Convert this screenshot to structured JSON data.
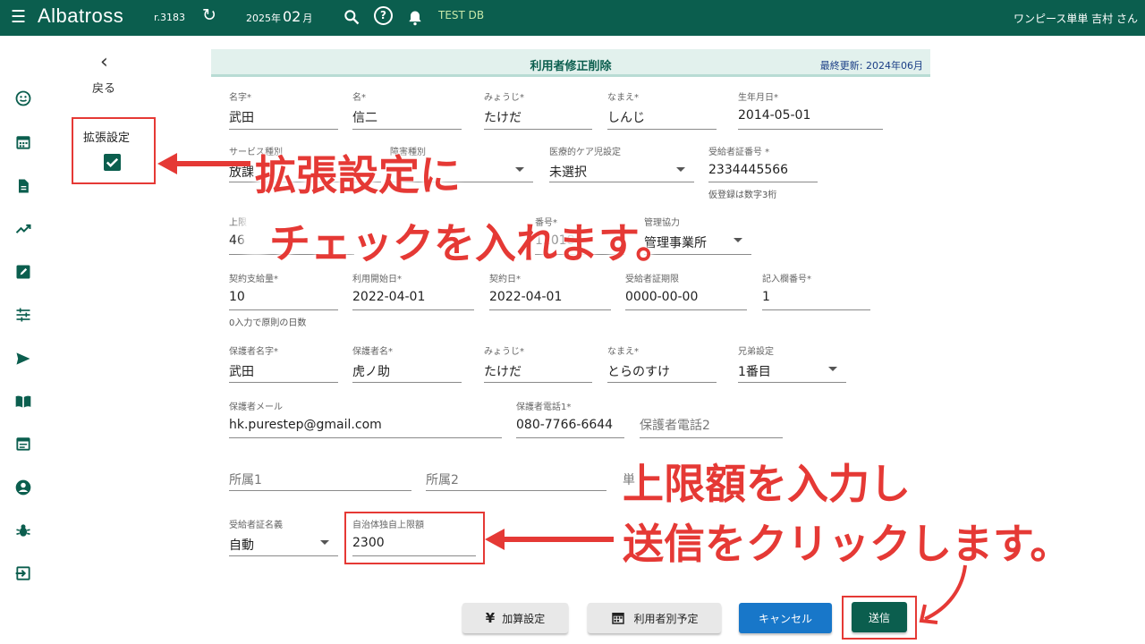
{
  "header": {
    "brand": "Albatross",
    "version": "r.3183",
    "month_year": "2025年",
    "month_num": "02",
    "month_unit": "月",
    "db_label": "TEST DB",
    "user": "ワンピース単単 吉村 さん"
  },
  "nav": {
    "back_label": "戻る",
    "ext_settings_label": "拡張設定",
    "ext_settings_checked": true,
    "rail_icons": [
      "smile-icon",
      "calendar-icon",
      "document-icon",
      "trending-icon",
      "edit-icon",
      "tune-icon",
      "send-icon",
      "book-icon",
      "schedule-icon",
      "account-icon",
      "bug-icon",
      "login-icon"
    ]
  },
  "page": {
    "title": "利用者修正削除",
    "updated": "最終更新: 2024年06月"
  },
  "form": {
    "row1": {
      "sei": {
        "label": "名字*",
        "value": "武田"
      },
      "mei": {
        "label": "名*",
        "value": "信二"
      },
      "sei_kana": {
        "label": "みょうじ*",
        "value": "たけだ"
      },
      "mei_kana": {
        "label": "なまえ*",
        "value": "しんじ"
      },
      "birthday": {
        "label": "生年月日*",
        "value": "2014-05-01"
      }
    },
    "row2": {
      "service": {
        "label": "サービス種別",
        "value": "放課"
      },
      "disability": {
        "label": "障害種別",
        "value": ""
      },
      "medical_care": {
        "label": "医療的ケア児設定",
        "value": "未選択"
      },
      "recipient_no": {
        "label": "受給者証番号 *",
        "value": "2334445566",
        "helper": "仮登録は数字3桁"
      }
    },
    "row3": {
      "limit": {
        "label": "上限",
        "value": "46"
      },
      "number": {
        "label": "番号*",
        "value": "12018"
      },
      "cooperation": {
        "label": "管理協力",
        "value": "管理事業所"
      }
    },
    "row4": {
      "contract_amount": {
        "label": "契約支給量*",
        "value": "10",
        "helper": "0入力で原則の日数"
      },
      "start_date": {
        "label": "利用開始日*",
        "value": "2022-04-01"
      },
      "contract_date": {
        "label": "契約日*",
        "value": "2022-04-01"
      },
      "cert_expiry": {
        "label": "受給者証期限",
        "value": "0000-00-00"
      },
      "entry_no": {
        "label": "記入欄番号*",
        "value": "1"
      }
    },
    "row5": {
      "guardian_sei": {
        "label": "保護者名字*",
        "value": "武田"
      },
      "guardian_mei": {
        "label": "保護者名*",
        "value": "虎ノ助"
      },
      "guardian_sei_kana": {
        "label": "みょうじ*",
        "value": "たけだ"
      },
      "guardian_mei_kana": {
        "label": "なまえ*",
        "value": "とらのすけ"
      },
      "sibling": {
        "label": "兄弟設定",
        "value": "1番目"
      }
    },
    "row6": {
      "email": {
        "label": "保護者メール",
        "value": "hk.purestep@gmail.com"
      },
      "tel1": {
        "label": "保護者電話1*",
        "value": "080-7766-6644"
      },
      "tel2": {
        "placeholder": "保護者電話2"
      }
    },
    "row7": {
      "affiliation1": {
        "placeholder": "所属1"
      },
      "affiliation2": {
        "placeholder": "所属2"
      },
      "unit": {
        "placeholder": "単"
      }
    },
    "row8": {
      "recipient_name": {
        "label": "受給者証名義",
        "value": "自動"
      },
      "municipal_limit": {
        "label": "自治体独自上限額",
        "value": "2300"
      }
    }
  },
  "buttons": {
    "addition": "加算設定",
    "schedule": "利用者別予定",
    "cancel": "キャンセル",
    "submit": "送信"
  },
  "annotations": {
    "a1_line1": "拡張設定に",
    "a1_line2": "チェックを入れます。",
    "a2_line1": "上限額を入力し",
    "a2_line2": "送信をクリックします。"
  },
  "colors": {
    "primary": "#0b5e4e",
    "accent_blue": "#1877c9",
    "annotation_red": "#e53935"
  }
}
